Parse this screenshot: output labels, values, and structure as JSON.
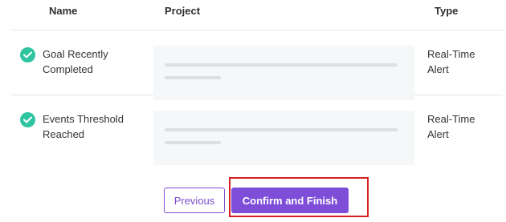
{
  "table": {
    "headers": {
      "name": "Name",
      "project": "Project",
      "type": "Type"
    },
    "rows": [
      {
        "name": "Goal Recently Completed",
        "type": "Real-Time Alert",
        "status_icon": "check-circle-icon"
      },
      {
        "name": "Events Threshold Reached",
        "type": "Real-Time Alert",
        "status_icon": "check-circle-icon"
      }
    ]
  },
  "actions": {
    "previous_label": "Previous",
    "confirm_label": "Confirm and Finish"
  },
  "colors": {
    "accent": "#7e4ed9",
    "success": "#2ec4a0",
    "highlight": "#d81e1e"
  }
}
